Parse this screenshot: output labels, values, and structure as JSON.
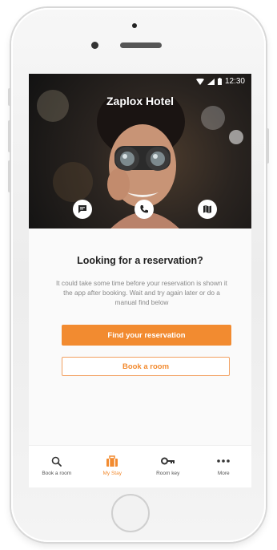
{
  "status_bar": {
    "time": "12:30"
  },
  "hotel": {
    "name": "Zaplox Hotel"
  },
  "hero_actions": [
    {
      "icon": "chat-icon"
    },
    {
      "icon": "phone-icon"
    },
    {
      "icon": "map-icon"
    }
  ],
  "main": {
    "heading": "Looking for a reservation?",
    "description": "It could take some time before your reservation is shown it the app after booking. Wait and try again later or do a manual find below",
    "primary_button": "Find your reservation",
    "secondary_button": "Book a room"
  },
  "tabs": [
    {
      "label": "Book a room",
      "icon": "search-icon",
      "active": false
    },
    {
      "label": "My Stay",
      "icon": "suitcase-icon",
      "active": true
    },
    {
      "label": "Room key",
      "icon": "key-icon",
      "active": false
    },
    {
      "label": "More",
      "icon": "more-icon",
      "active": false
    }
  ],
  "colors": {
    "accent": "#f28b30",
    "hero_bg": "#2a2420"
  }
}
